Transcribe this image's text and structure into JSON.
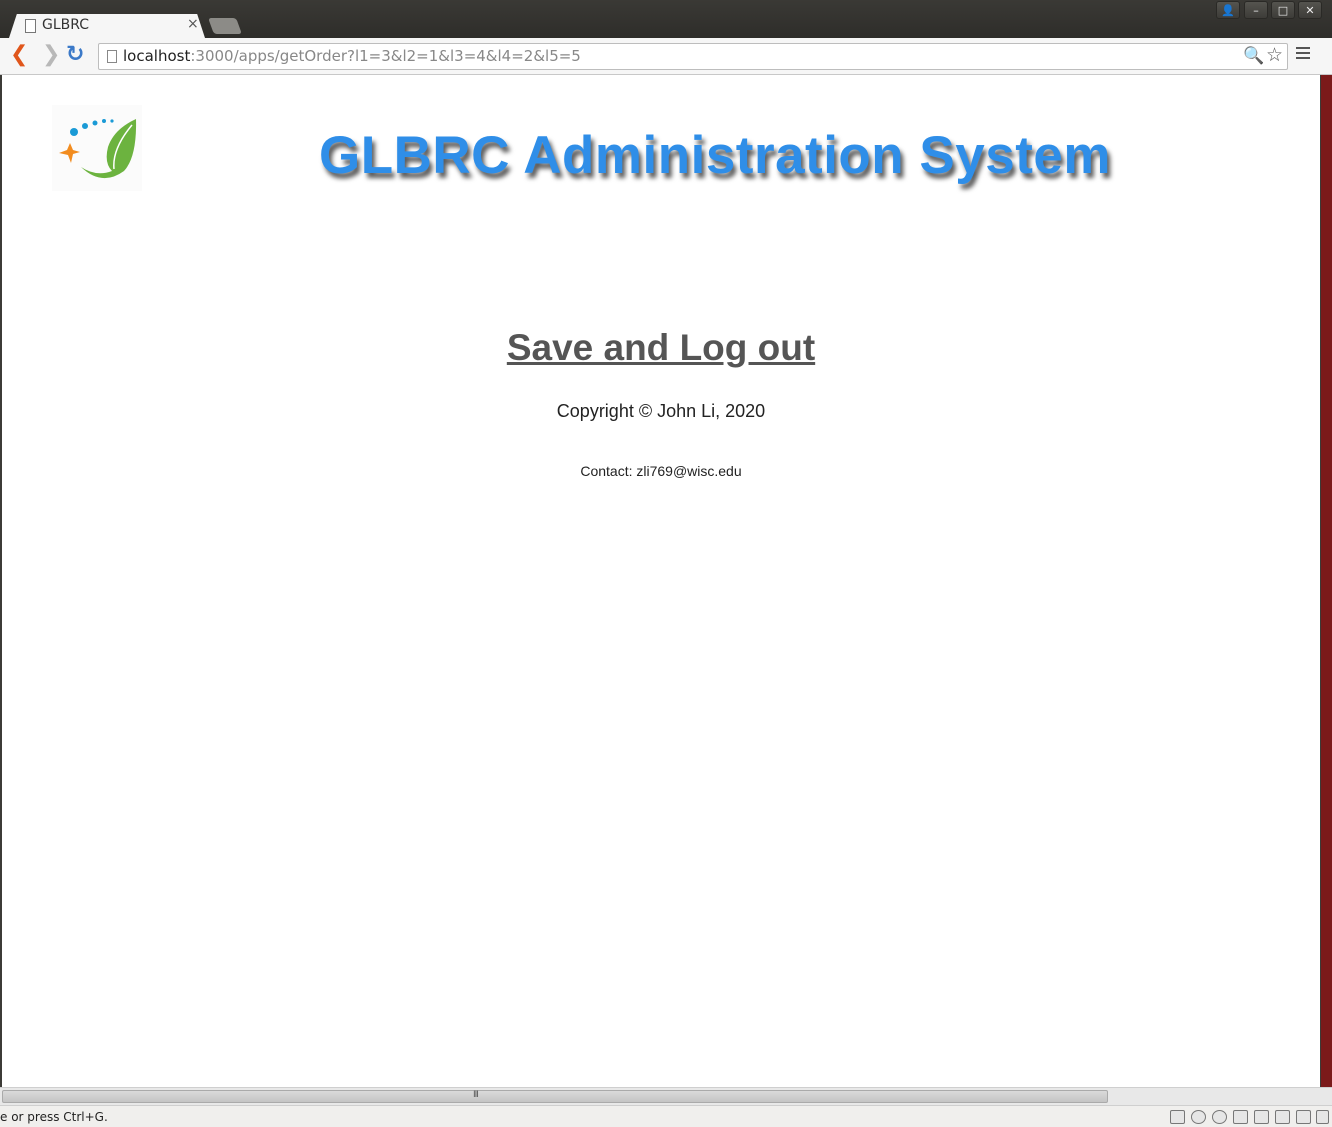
{
  "browser": {
    "tab_title": "GLBRC",
    "tab_close": "×",
    "url_host": "localhost",
    "url_path": ":3000/apps/getOrder?l1=3&l2=1&l3=4&l4=2&l5=5",
    "window_buttons": {
      "user": "👤",
      "minimize": "–",
      "maximize": "□",
      "close": "✕"
    },
    "nav": {
      "back": "❮",
      "forward": "❯",
      "reload": "↻"
    },
    "omnibox_icons": {
      "search": "🔍",
      "bookmark": "☆"
    }
  },
  "page": {
    "title": "GLBRC Administration System",
    "logout_link": "Save and Log out",
    "copyright": "Copyright © John Li, 2020",
    "contact": "Contact: zli769@wisc.edu"
  },
  "status_bar": {
    "message": "e or press Ctrl+G.",
    "scroll_grip": "III"
  },
  "colors": {
    "title": "#2f8ee8",
    "link": "#555555",
    "logo_leaf": "#6cb33f",
    "logo_dots": "#1a9ad6",
    "logo_star": "#f28c1f"
  }
}
